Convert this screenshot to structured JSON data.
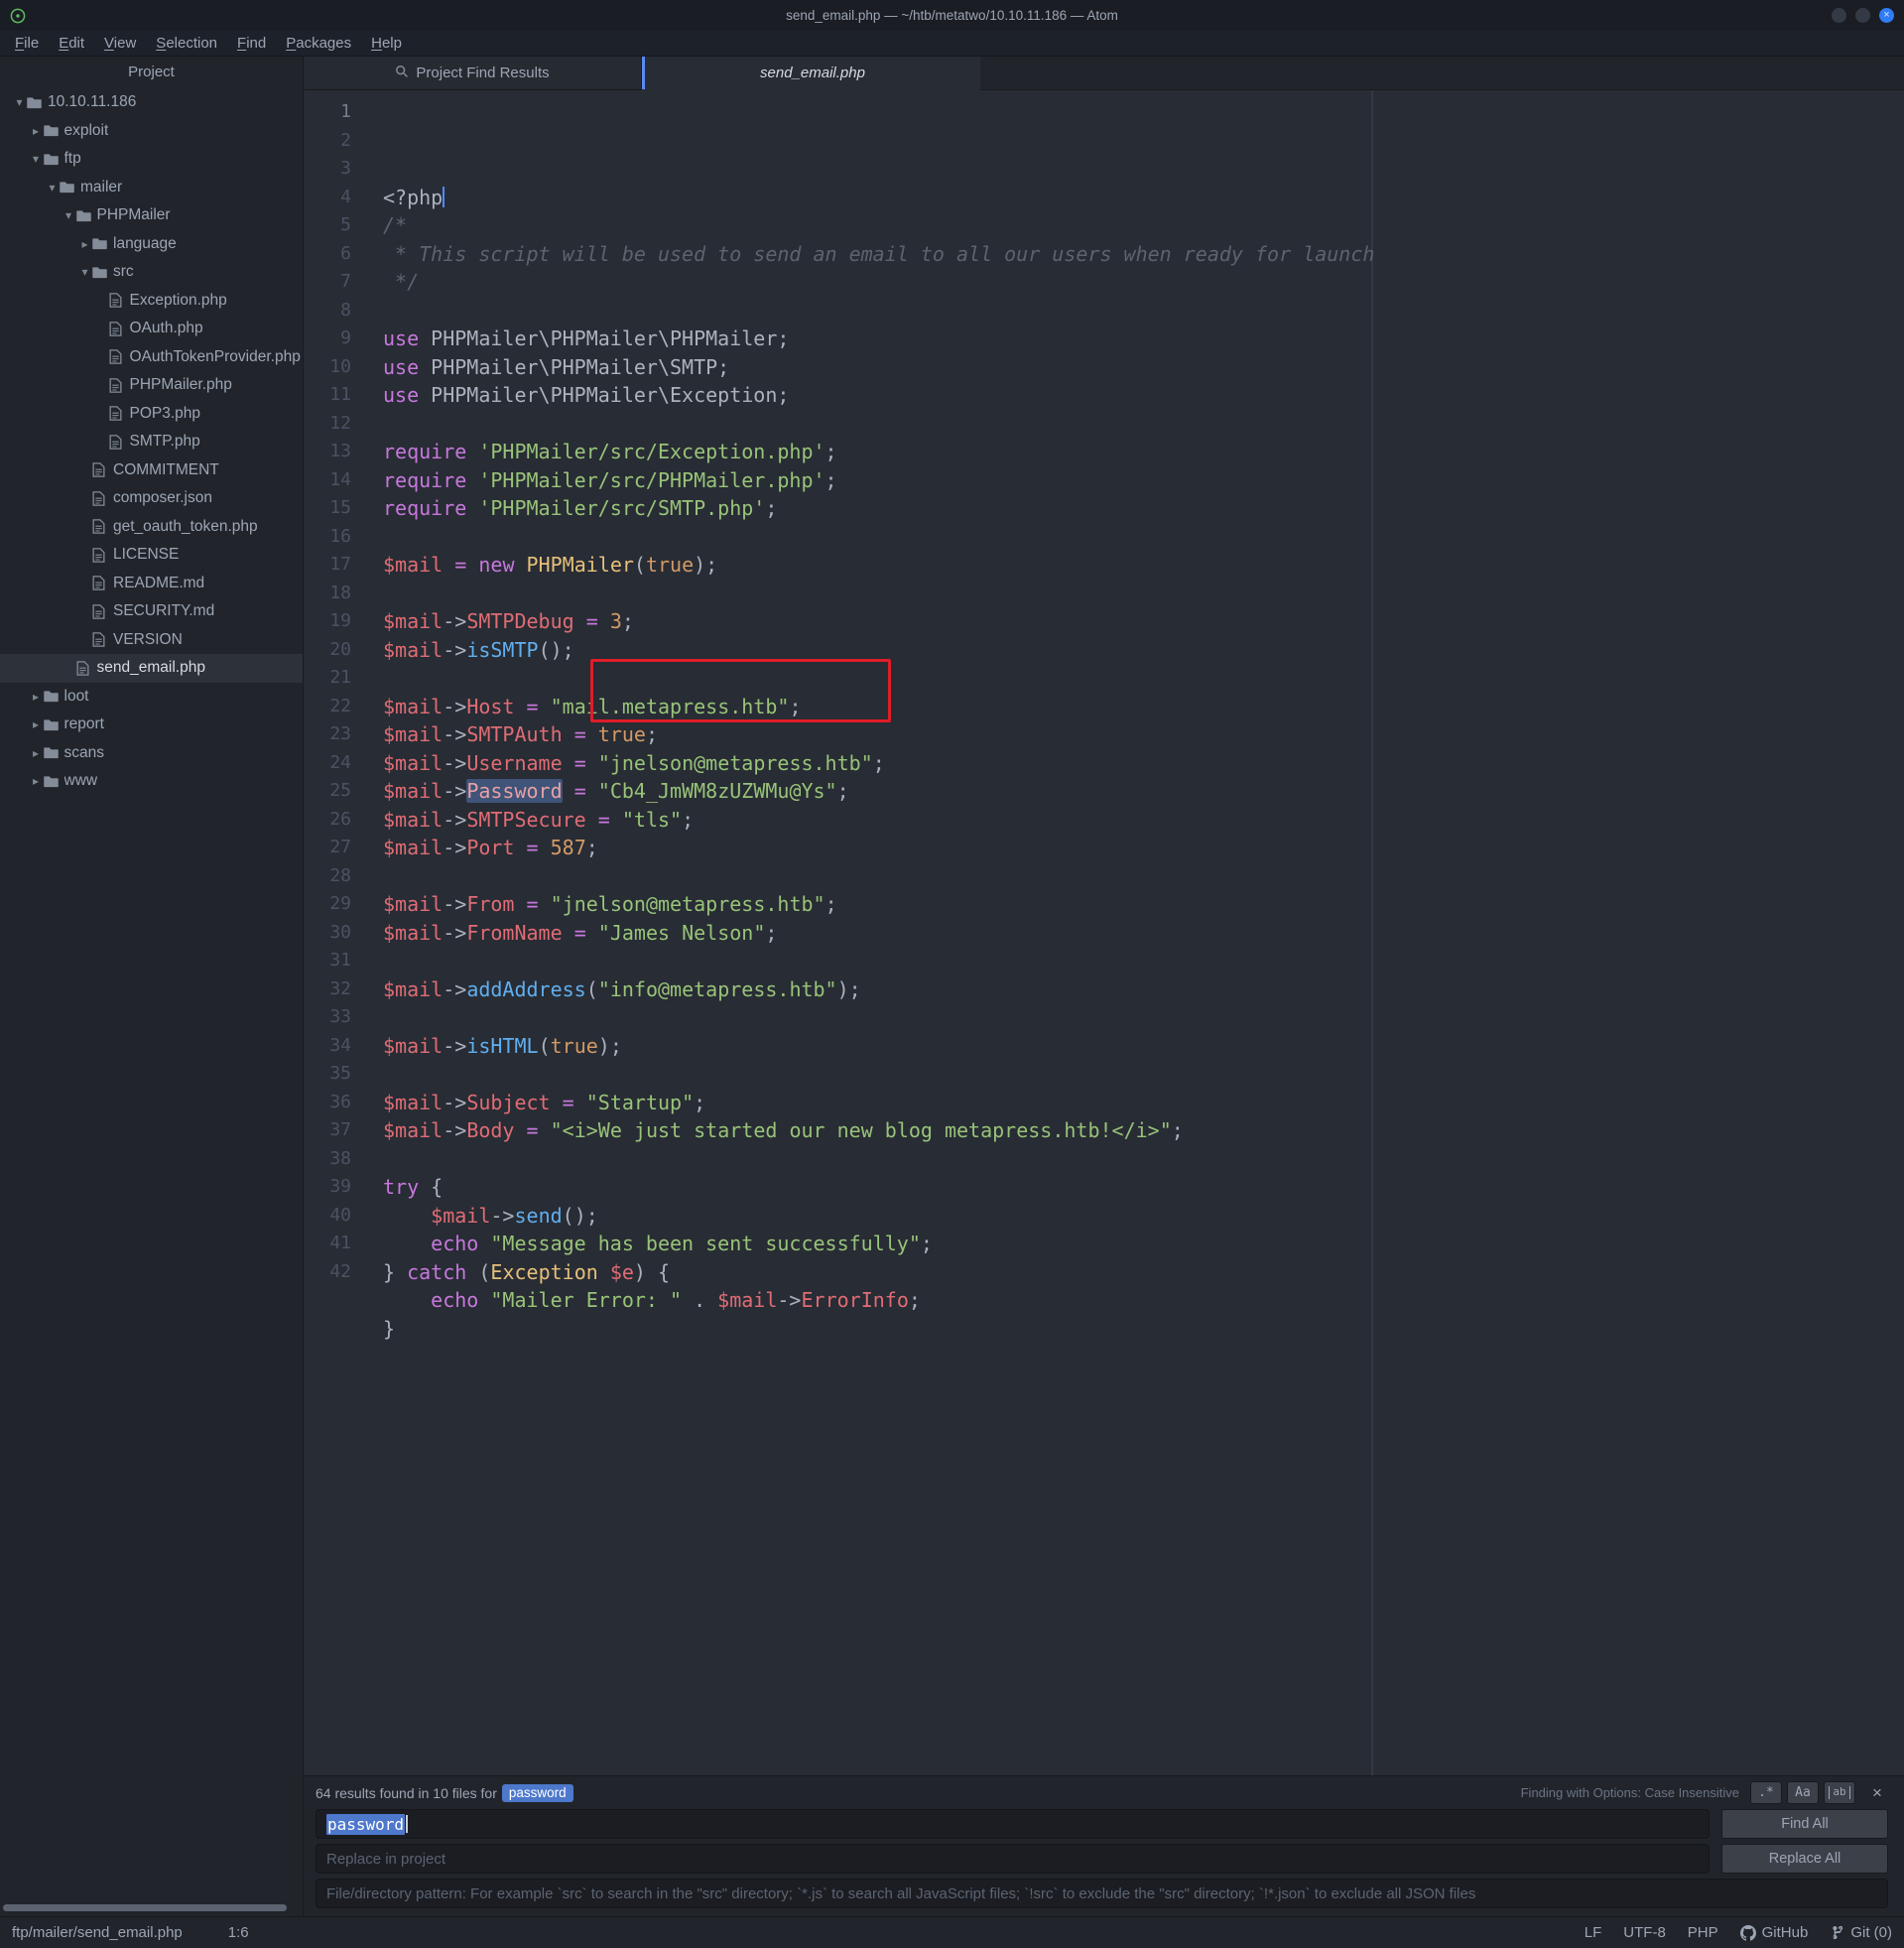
{
  "colors": {
    "editor_bg": "#282c34",
    "panel_bg": "#21252b",
    "accent_blue": "#5b8af5",
    "badge_blue": "#4d78cc",
    "annotation_red": "#df1d28",
    "syntax_keyword": "#c678dd",
    "syntax_variable": "#e06c75",
    "syntax_string": "#98c379",
    "syntax_constant": "#d19a66",
    "syntax_class": "#e5c07b",
    "syntax_function": "#61afef",
    "syntax_comment": "#5c6370"
  },
  "title_bar": {
    "title": "send_email.php — ~/htb/metatwo/10.10.11.186 — Atom",
    "close_glyph": "×"
  },
  "menu": [
    "File",
    "Edit",
    "View",
    "Selection",
    "Find",
    "Packages",
    "Help"
  ],
  "tree": {
    "header": "Project",
    "items": [
      {
        "label": "10.10.11.186",
        "depth": 0,
        "type": "folder-open"
      },
      {
        "label": "exploit",
        "depth": 1,
        "type": "folder-closed"
      },
      {
        "label": "ftp",
        "depth": 1,
        "type": "folder-open"
      },
      {
        "label": "mailer",
        "depth": 2,
        "type": "folder-open"
      },
      {
        "label": "PHPMailer",
        "depth": 3,
        "type": "folder-open"
      },
      {
        "label": "language",
        "depth": 4,
        "type": "folder-closed"
      },
      {
        "label": "src",
        "depth": 4,
        "type": "folder-open"
      },
      {
        "label": "Exception.php",
        "depth": 5,
        "type": "file"
      },
      {
        "label": "OAuth.php",
        "depth": 5,
        "type": "file"
      },
      {
        "label": "OAuthTokenProvider.php",
        "depth": 5,
        "type": "file"
      },
      {
        "label": "PHPMailer.php",
        "depth": 5,
        "type": "file"
      },
      {
        "label": "POP3.php",
        "depth": 5,
        "type": "file"
      },
      {
        "label": "SMTP.php",
        "depth": 5,
        "type": "file"
      },
      {
        "label": "COMMITMENT",
        "depth": 4,
        "type": "file"
      },
      {
        "label": "composer.json",
        "depth": 4,
        "type": "file"
      },
      {
        "label": "get_oauth_token.php",
        "depth": 4,
        "type": "file"
      },
      {
        "label": "LICENSE",
        "depth": 4,
        "type": "file"
      },
      {
        "label": "README.md",
        "depth": 4,
        "type": "file"
      },
      {
        "label": "SECURITY.md",
        "depth": 4,
        "type": "file"
      },
      {
        "label": "VERSION",
        "depth": 4,
        "type": "file"
      },
      {
        "label": "send_email.php",
        "depth": 3,
        "type": "file",
        "selected": true
      },
      {
        "label": "loot",
        "depth": 1,
        "type": "folder-closed"
      },
      {
        "label": "report",
        "depth": 1,
        "type": "folder-closed"
      },
      {
        "label": "scans",
        "depth": 1,
        "type": "folder-closed"
      },
      {
        "label": "www",
        "depth": 1,
        "type": "folder-closed"
      }
    ]
  },
  "tabs": [
    {
      "label": "Project Find Results",
      "active": false
    },
    {
      "label": "send_email.php",
      "active": true
    }
  ],
  "editor": {
    "active_line": 1,
    "annotation_lines": [
      21,
      22
    ],
    "lines": [
      [
        [
          "r",
          "<?php"
        ],
        [
          "caret",
          ""
        ]
      ],
      [
        [
          "c",
          "/*"
        ]
      ],
      [
        [
          "c",
          " * This script will be used to send an email to all our users when ready for launch"
        ]
      ],
      [
        [
          "c",
          " */"
        ]
      ],
      [],
      [
        [
          "k",
          "use"
        ],
        [
          "o",
          " PHPMailer\\PHPMailer\\PHPMailer;"
        ]
      ],
      [
        [
          "k",
          "use"
        ],
        [
          "o",
          " PHPMailer\\PHPMailer\\SMTP;"
        ]
      ],
      [
        [
          "k",
          "use"
        ],
        [
          "o",
          " PHPMailer\\PHPMailer\\Exception;"
        ]
      ],
      [],
      [
        [
          "k",
          "require"
        ],
        [
          "o",
          " "
        ],
        [
          "s",
          "'PHPMailer/src/Exception.php'"
        ],
        [
          "o",
          ";"
        ]
      ],
      [
        [
          "k",
          "require"
        ],
        [
          "o",
          " "
        ],
        [
          "s",
          "'PHPMailer/src/PHPMailer.php'"
        ],
        [
          "o",
          ";"
        ]
      ],
      [
        [
          "k",
          "require"
        ],
        [
          "o",
          " "
        ],
        [
          "s",
          "'PHPMailer/src/SMTP.php'"
        ],
        [
          "o",
          ";"
        ]
      ],
      [],
      [
        [
          "v",
          "$mail"
        ],
        [
          "o",
          " "
        ],
        [
          "eq",
          "="
        ],
        [
          "o",
          " "
        ],
        [
          "k",
          "new"
        ],
        [
          "o",
          " "
        ],
        [
          "t",
          "PHPMailer"
        ],
        [
          "o",
          "("
        ],
        [
          "n",
          "true"
        ],
        [
          "o",
          ");"
        ]
      ],
      [],
      [
        [
          "v",
          "$mail"
        ],
        [
          "o",
          "->"
        ],
        [
          "p",
          "SMTPDebug"
        ],
        [
          "o",
          " "
        ],
        [
          "eq",
          "="
        ],
        [
          "o",
          " "
        ],
        [
          "n",
          "3"
        ],
        [
          "o",
          ";"
        ]
      ],
      [
        [
          "v",
          "$mail"
        ],
        [
          "o",
          "->"
        ],
        [
          "f",
          "isSMTP"
        ],
        [
          "o",
          "();"
        ]
      ],
      [],
      [
        [
          "v",
          "$mail"
        ],
        [
          "o",
          "->"
        ],
        [
          "p",
          "Host"
        ],
        [
          "o",
          " "
        ],
        [
          "eq",
          "="
        ],
        [
          "o",
          " "
        ],
        [
          "s",
          "\"mail.metapress.htb\""
        ],
        [
          "o",
          ";"
        ]
      ],
      [
        [
          "v",
          "$mail"
        ],
        [
          "o",
          "->"
        ],
        [
          "p",
          "SMTPAuth"
        ],
        [
          "o",
          " "
        ],
        [
          "eq",
          "="
        ],
        [
          "o",
          " "
        ],
        [
          "n",
          "true"
        ],
        [
          "o",
          ";"
        ]
      ],
      [
        [
          "v",
          "$mail"
        ],
        [
          "o",
          "->"
        ],
        [
          "p",
          "Username"
        ],
        [
          "o",
          " "
        ],
        [
          "eq",
          "="
        ],
        [
          "o",
          " "
        ],
        [
          "s",
          "\"jnelson@metapress.htb\""
        ],
        [
          "o",
          ";"
        ]
      ],
      [
        [
          "v",
          "$mail"
        ],
        [
          "o",
          "->"
        ],
        [
          "hl",
          "Password"
        ],
        [
          "o",
          " "
        ],
        [
          "eq",
          "="
        ],
        [
          "o",
          " "
        ],
        [
          "s",
          "\"Cb4_JmWM8zUZWMu@Ys\""
        ],
        [
          "o",
          ";"
        ]
      ],
      [
        [
          "v",
          "$mail"
        ],
        [
          "o",
          "->"
        ],
        [
          "p",
          "SMTPSecure"
        ],
        [
          "o",
          " "
        ],
        [
          "eq",
          "="
        ],
        [
          "o",
          " "
        ],
        [
          "s",
          "\"tls\""
        ],
        [
          "o",
          ";"
        ]
      ],
      [
        [
          "v",
          "$mail"
        ],
        [
          "o",
          "->"
        ],
        [
          "p",
          "Port"
        ],
        [
          "o",
          " "
        ],
        [
          "eq",
          "="
        ],
        [
          "o",
          " "
        ],
        [
          "n",
          "587"
        ],
        [
          "o",
          ";"
        ]
      ],
      [],
      [
        [
          "v",
          "$mail"
        ],
        [
          "o",
          "->"
        ],
        [
          "p",
          "From"
        ],
        [
          "o",
          " "
        ],
        [
          "eq",
          "="
        ],
        [
          "o",
          " "
        ],
        [
          "s",
          "\"jnelson@metapress.htb\""
        ],
        [
          "o",
          ";"
        ]
      ],
      [
        [
          "v",
          "$mail"
        ],
        [
          "o",
          "->"
        ],
        [
          "p",
          "FromName"
        ],
        [
          "o",
          " "
        ],
        [
          "eq",
          "="
        ],
        [
          "o",
          " "
        ],
        [
          "s",
          "\"James Nelson\""
        ],
        [
          "o",
          ";"
        ]
      ],
      [],
      [
        [
          "v",
          "$mail"
        ],
        [
          "o",
          "->"
        ],
        [
          "f",
          "addAddress"
        ],
        [
          "o",
          "("
        ],
        [
          "s",
          "\"info@metapress.htb\""
        ],
        [
          "o",
          ");"
        ]
      ],
      [],
      [
        [
          "v",
          "$mail"
        ],
        [
          "o",
          "->"
        ],
        [
          "f",
          "isHTML"
        ],
        [
          "o",
          "("
        ],
        [
          "n",
          "true"
        ],
        [
          "o",
          ");"
        ]
      ],
      [],
      [
        [
          "v",
          "$mail"
        ],
        [
          "o",
          "->"
        ],
        [
          "p",
          "Subject"
        ],
        [
          "o",
          " "
        ],
        [
          "eq",
          "="
        ],
        [
          "o",
          " "
        ],
        [
          "s",
          "\"Startup\""
        ],
        [
          "o",
          ";"
        ]
      ],
      [
        [
          "v",
          "$mail"
        ],
        [
          "o",
          "->"
        ],
        [
          "p",
          "Body"
        ],
        [
          "o",
          " "
        ],
        [
          "eq",
          "="
        ],
        [
          "o",
          " "
        ],
        [
          "s",
          "\"<i>We just started our new blog metapress.htb!</i>\""
        ],
        [
          "o",
          ";"
        ]
      ],
      [],
      [
        [
          "k",
          "try"
        ],
        [
          "o",
          " {"
        ]
      ],
      [
        [
          "o",
          "    "
        ],
        [
          "v",
          "$mail"
        ],
        [
          "o",
          "->"
        ],
        [
          "f",
          "send"
        ],
        [
          "o",
          "();"
        ]
      ],
      [
        [
          "o",
          "    "
        ],
        [
          "k",
          "echo"
        ],
        [
          "o",
          " "
        ],
        [
          "s",
          "\"Message has been sent successfully\""
        ],
        [
          "o",
          ";"
        ]
      ],
      [
        [
          "o",
          "} "
        ],
        [
          "k",
          "catch"
        ],
        [
          "o",
          " ("
        ],
        [
          "t",
          "Exception"
        ],
        [
          "o",
          " "
        ],
        [
          "v",
          "$e"
        ],
        [
          "o",
          ") {"
        ]
      ],
      [
        [
          "o",
          "    "
        ],
        [
          "k",
          "echo"
        ],
        [
          "o",
          " "
        ],
        [
          "s",
          "\"Mailer Error: \""
        ],
        [
          "o",
          " . "
        ],
        [
          "v",
          "$mail"
        ],
        [
          "o",
          "->"
        ],
        [
          "p",
          "ErrorInfo"
        ],
        [
          "o",
          ";"
        ]
      ],
      [
        [
          "o",
          "}"
        ]
      ],
      []
    ]
  },
  "find_panel": {
    "results_prefix": "64 results found in 10 files for ",
    "results_badge": "password",
    "options_label": "Finding with Options: Case Insensitive",
    "option_buttons": [
      ".*",
      "Aa",
      "ab"
    ],
    "close_glyph": "×",
    "find_value": "password",
    "find_all_label": "Find All",
    "replace_placeholder": "Replace in project",
    "replace_all_label": "Replace All",
    "pattern_placeholder": "File/directory pattern: For example `src` to search in the \"src\" directory; `*.js` to search all JavaScript files; `!src` to exclude the \"src\" directory; `!*.json` to exclude all JSON files"
  },
  "status_bar": {
    "path": "ftp/mailer/send_email.php",
    "cursor": "1:6",
    "eol": "LF",
    "encoding": "UTF-8",
    "grammar": "PHP",
    "github_label": "GitHub",
    "git_label": "Git (0)"
  }
}
